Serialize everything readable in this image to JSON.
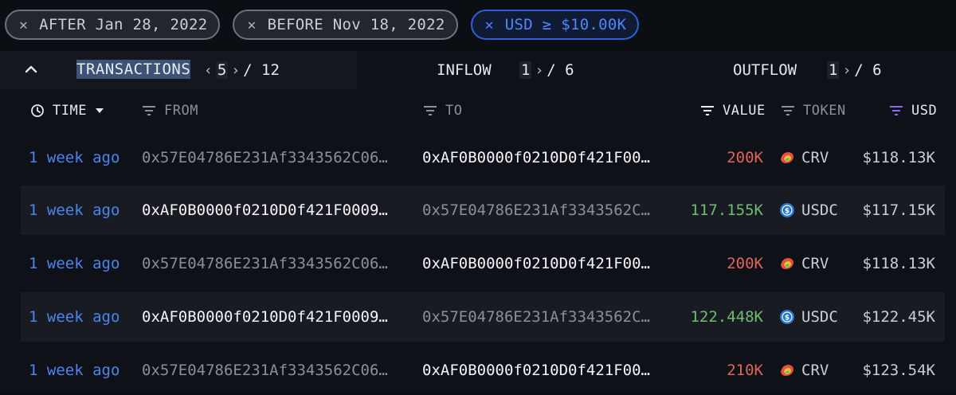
{
  "filters": [
    {
      "label": "AFTER Jan 28, 2022",
      "color": "gray"
    },
    {
      "label": "BEFORE Nov 18, 2022",
      "color": "gray"
    },
    {
      "label": "USD ≥ $10.00K",
      "color": "blue"
    }
  ],
  "tabs": {
    "transactions": {
      "label": "TRANSACTIONS",
      "page": "5",
      "total": "/ 12"
    },
    "inflow": {
      "label": "INFLOW",
      "page": "1",
      "total": "/ 6"
    },
    "outflow": {
      "label": "OUTFLOW",
      "page": "1",
      "total": "/ 6"
    }
  },
  "columns": {
    "time": "TIME",
    "from": "FROM",
    "to": "TO",
    "value": "VALUE",
    "token": "TOKEN",
    "usd": "USD"
  },
  "rows": [
    {
      "time": "1 week ago",
      "from": "0x57E04786E231Af3343562C06…",
      "to": "0xAF0B0000f0210D0f421F00…",
      "value": "200K",
      "direction": "out",
      "token": "CRV",
      "usd": "$118.13K"
    },
    {
      "time": "1 week ago",
      "from": "0xAF0B0000f0210D0f421F0009…",
      "to": "0x57E04786E231Af3343562C…",
      "value": "117.155K",
      "direction": "in",
      "token": "USDC",
      "usd": "$117.15K"
    },
    {
      "time": "1 week ago",
      "from": "0x57E04786E231Af3343562C06…",
      "to": "0xAF0B0000f0210D0f421F00…",
      "value": "200K",
      "direction": "out",
      "token": "CRV",
      "usd": "$118.13K"
    },
    {
      "time": "1 week ago",
      "from": "0xAF0B0000f0210D0f421F0009…",
      "to": "0x57E04786E231Af3343562C…",
      "value": "122.448K",
      "direction": "in",
      "token": "USDC",
      "usd": "$122.45K"
    },
    {
      "time": "1 week ago",
      "from": "0x57E04786E231Af3343562C06…",
      "to": "0xAF0B0000f0210D0f421F00…",
      "value": "210K",
      "direction": "out",
      "token": "CRV",
      "usd": "$123.54K"
    }
  ],
  "colors": {
    "link_blue": "#4a86f0",
    "outflow_red": "#e0645a",
    "inflow_green": "#6fbd72",
    "active_sort": "#8b6cf0"
  }
}
